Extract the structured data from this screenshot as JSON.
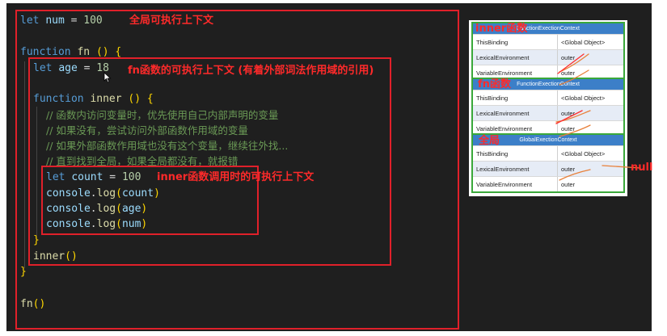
{
  "code": {
    "line1": {
      "kw": "let",
      "name": "num",
      "op": "=",
      "val": "100"
    },
    "line2": {
      "kw": "function",
      "name": "fn",
      "parens": "()",
      "brace": "{"
    },
    "line3": {
      "kw": "let",
      "name": "age",
      "op": "=",
      "val": "18"
    },
    "line4": {
      "kw": "function",
      "name": "inner",
      "parens": "()",
      "brace": "{"
    },
    "comments": [
      "// 函数内访问变量时，优先使用自己内部声明的变量",
      "// 如果没有，尝试访问外部函数作用域的变量",
      "// 如果外部函数作用域也没有这个变量，继续往外找...",
      "// 直到找到全局，如果全局都没有，就报错"
    ],
    "line9": {
      "kw": "let",
      "name": "count",
      "op": "=",
      "val": "100"
    },
    "logs": [
      {
        "obj": "console",
        "method": "log",
        "arg": "count"
      },
      {
        "obj": "console",
        "method": "log",
        "arg": "age"
      },
      {
        "obj": "console",
        "method": "log",
        "arg": "num"
      }
    ],
    "close_inner": "}",
    "call_inner": {
      "name": "inner",
      "parens": "()"
    },
    "close_fn": "}",
    "call_fn": {
      "name": "fn",
      "parens": "()"
    }
  },
  "annotations": {
    "global": "全局可执行上下文",
    "fn": "fn函数的可执行上下文 (有着外部词法作用域的引用)",
    "inner": "inner函数调用时的可执行上下文"
  },
  "diagram": {
    "contexts": [
      {
        "label": "inner函数",
        "header": "FunctionExectionContext",
        "rows": [
          {
            "key": "ThisBinding",
            "value": "<Global Object>"
          },
          {
            "key": "LexicalEnvironment",
            "value": "outer"
          },
          {
            "key": "VariableEnvironment",
            "value": "outer"
          }
        ]
      },
      {
        "label": "fn函数",
        "header": "FunctionExectionContext",
        "rows": [
          {
            "key": "ThisBinding",
            "value": "<Global Object>"
          },
          {
            "key": "LexicalEnvironment",
            "value": "outer"
          },
          {
            "key": "VariableEnvironment",
            "value": "outer"
          }
        ]
      },
      {
        "label": "全局",
        "header": "GlobalExectionContext",
        "rows": [
          {
            "key": "ThisBinding",
            "value": "<Global Object>"
          },
          {
            "key": "LexicalEnvironment",
            "value": "outer"
          },
          {
            "key": "VariableEnvironment",
            "value": "outer"
          }
        ]
      }
    ],
    "null_label": "null"
  },
  "colors": {
    "annotation": "#ff2a2a",
    "box": "#e0202a",
    "context_border": "#3aa83a",
    "header_bg": "#3c7fc8"
  }
}
